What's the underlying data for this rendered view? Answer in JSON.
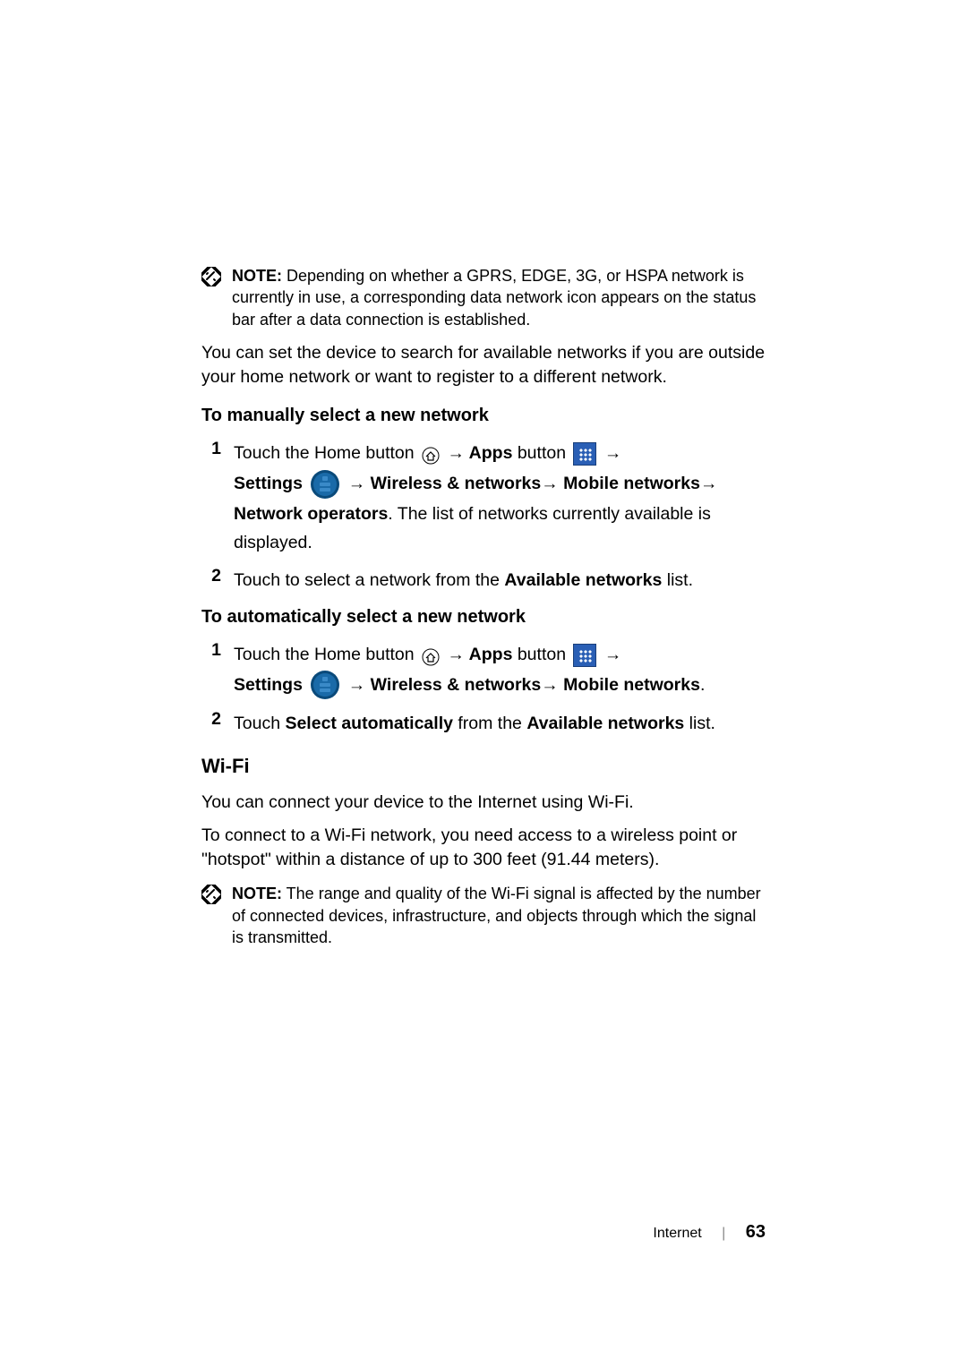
{
  "note1": {
    "label": "NOTE:",
    "text": " Depending on whether a GPRS, EDGE, 3G, or HSPA network is currently in use, a corresponding data network icon appears on the status bar after a data connection is established."
  },
  "intro_text": "You can set the device to search for available networks if you are outside your home network or want to register to a different network.",
  "section1": {
    "heading": "To manually select a new network",
    "step1": {
      "num": "1",
      "p1a": "Touch the Home button ",
      "p1b": " Apps",
      "p1c": " button ",
      "p2a": "Settings ",
      "p2b": " Wireless & networks",
      "p2c": " Mobile networks",
      "p3a": "Network operators",
      "p3b": ". The list of networks currently available is displayed."
    },
    "step2": {
      "num": "2",
      "text_a": "Touch to select a network from the ",
      "text_b": "Available networks",
      "text_c": " list."
    }
  },
  "section2": {
    "heading": "To automatically select a new network",
    "step1": {
      "num": "1",
      "p1a": "Touch the Home button ",
      "p1b": " Apps",
      "p1c": " button ",
      "p2a": "Settings ",
      "p2b": " Wireless & networks",
      "p2c": " Mobile networks"
    },
    "step2": {
      "num": "2",
      "text_a": "Touch ",
      "text_b": "Select automatically",
      "text_c": " from the ",
      "text_d": "Available networks",
      "text_e": " list."
    }
  },
  "wifi": {
    "heading": "Wi-Fi",
    "para1": "You can connect your device to the Internet using Wi-Fi.",
    "para2": "To connect to a Wi-Fi network, you need access to a wireless point or \"hotspot\" within a distance of up to 300 feet (91.44 meters)."
  },
  "note2": {
    "label": "NOTE:",
    "text": " The range and quality of the Wi-Fi signal is affected by the number of connected devices, infrastructure, and objects through which the signal is transmitted."
  },
  "footer": {
    "section": "Internet",
    "page": "63"
  },
  "arrow": "→"
}
